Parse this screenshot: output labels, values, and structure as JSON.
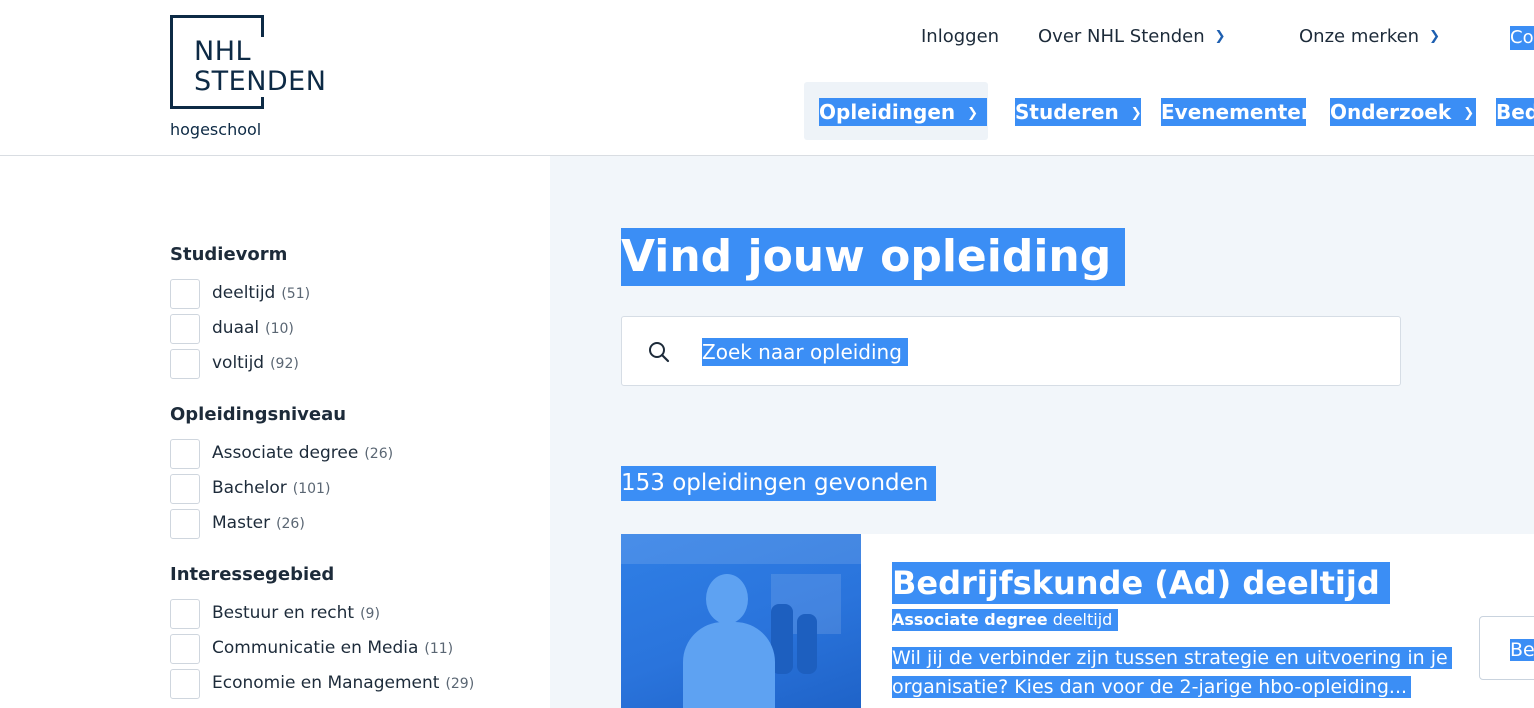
{
  "brand": {
    "name": "NHL\nSTENDEN",
    "sub": "hogeschool",
    "colors": {
      "navy": "#0d2a45",
      "selection": "#3b8ef5",
      "main_bg": "#f2f6fa"
    }
  },
  "topnav": {
    "login": "Inloggen",
    "about": "Over NHL Stenden",
    "brands": "Onze merken",
    "cut_item": "Co"
  },
  "mainnav": {
    "items": [
      {
        "label": "Opleidingen",
        "has_chevron": true,
        "active": true
      },
      {
        "label": "Studeren",
        "has_chevron": true
      },
      {
        "label": "Evenementen",
        "has_chevron": false
      },
      {
        "label": "Onderzoek",
        "has_chevron": true
      },
      {
        "label": "Bed",
        "has_chevron": false
      }
    ]
  },
  "filters": {
    "studievorm": {
      "title": "Studievorm",
      "options": [
        {
          "label": "deeltijd",
          "count": "(51)"
        },
        {
          "label": "duaal",
          "count": "(10)"
        },
        {
          "label": "voltijd",
          "count": "(92)"
        }
      ]
    },
    "niveau": {
      "title": "Opleidingsniveau",
      "options": [
        {
          "label": "Associate degree",
          "count": "(26)"
        },
        {
          "label": "Bachelor",
          "count": "(101)"
        },
        {
          "label": "Master",
          "count": "(26)"
        }
      ]
    },
    "interesse": {
      "title": "Interessegebied",
      "options": [
        {
          "label": "Bestuur en recht",
          "count": "(9)"
        },
        {
          "label": "Communicatie en Media",
          "count": "(11)"
        },
        {
          "label": "Economie en Management",
          "count": "(29)"
        }
      ]
    }
  },
  "main": {
    "title": "Vind jouw opleiding",
    "search_placeholder": "Zoek naar opleiding",
    "results": "153 opleidingen gevonden"
  },
  "card": {
    "title": "Bedrijfskunde (Ad) deeltijd",
    "level": "Associate degree",
    "form": "deeltijd",
    "desc_line1": "Wil jij de verbinder zijn tussen strategie en uitvoering in je",
    "desc_line2": "organisatie? Kies dan voor de 2-jarige hbo-opleiding...",
    "button_label": "Be"
  }
}
